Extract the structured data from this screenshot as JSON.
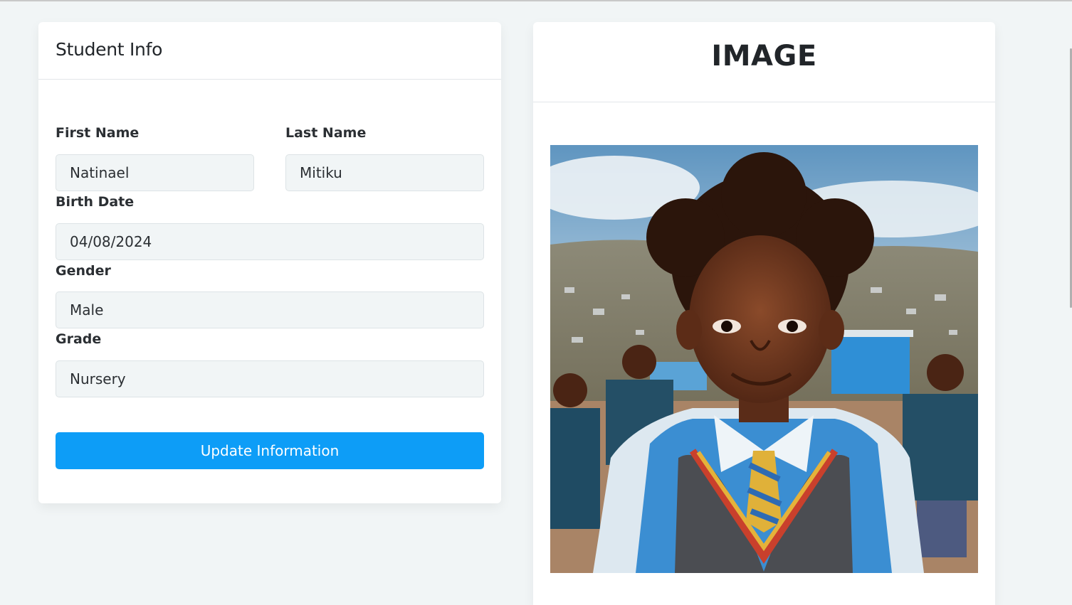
{
  "student_info": {
    "title": "Student Info",
    "first_name": {
      "label": "First Name",
      "value": "Natinael"
    },
    "last_name": {
      "label": "Last Name",
      "value": "Mitiku"
    },
    "birth_date": {
      "label": "Birth Date",
      "value": "04/08/2024"
    },
    "gender": {
      "label": "Gender",
      "value": "Male"
    },
    "grade": {
      "label": "Grade",
      "value": "Nursery"
    },
    "update_button": "Update Information"
  },
  "image_panel": {
    "title": "IMAGE",
    "photo_description": "student-photo"
  },
  "colors": {
    "accent": "#0d9df7",
    "page_background": "#f1f5f6",
    "field_background": "#f1f5f6"
  }
}
